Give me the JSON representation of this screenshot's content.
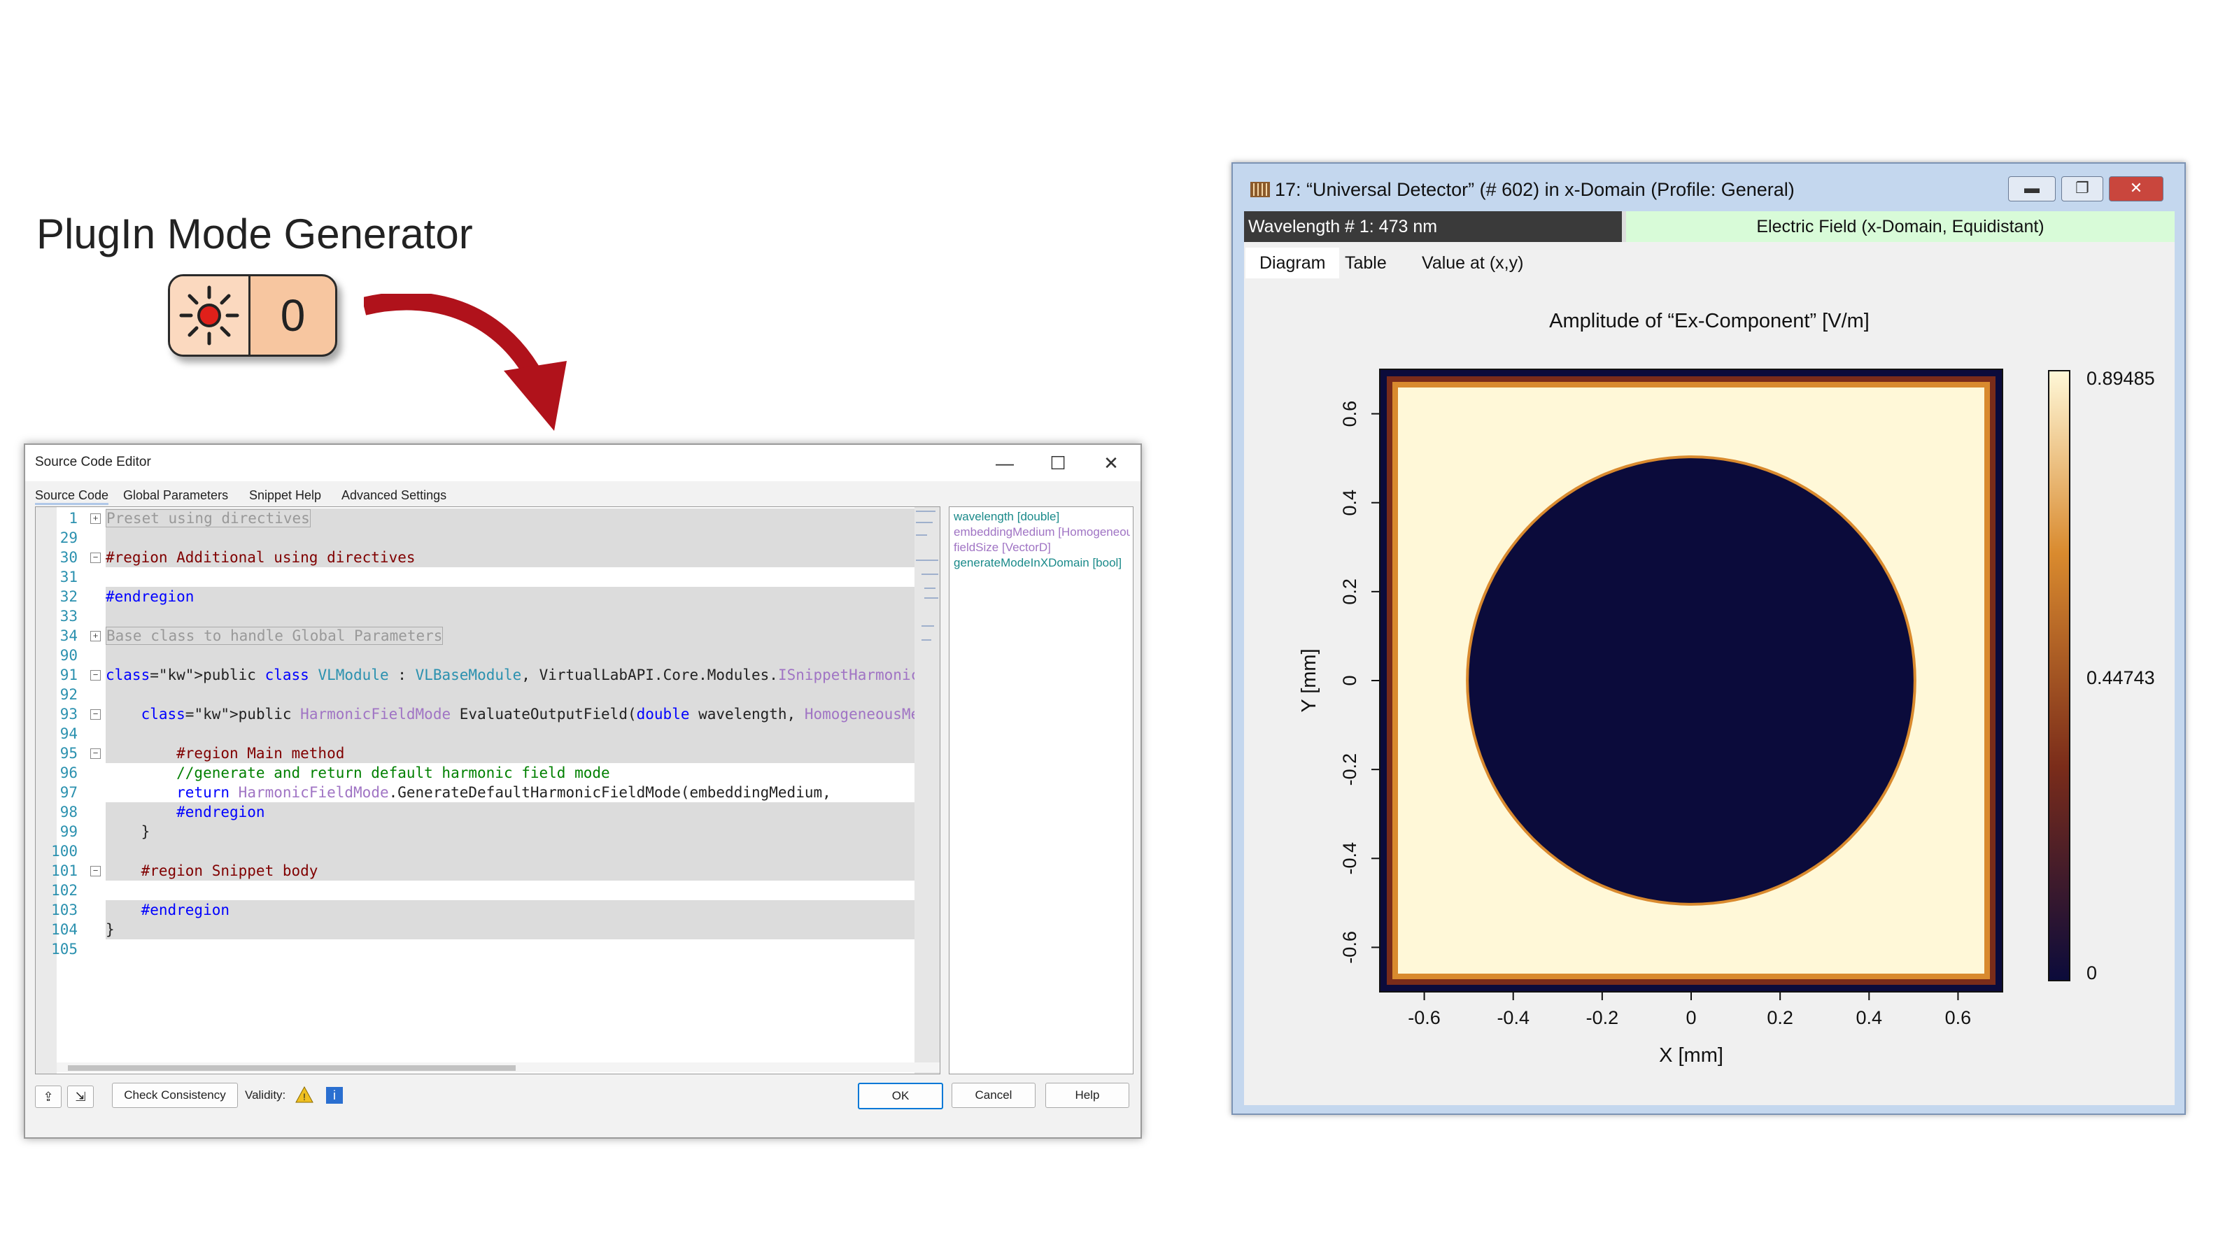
{
  "plugin": {
    "title": "PlugIn Mode Generator",
    "count": "0",
    "icon": "sun-light-source-icon"
  },
  "editor": {
    "title": "Source Code Editor",
    "tabs": [
      "Source Code",
      "Global Parameters",
      "Snippet Help",
      "Advanced Settings"
    ],
    "window_buttons": {
      "minimize": "—",
      "maximize": "☐",
      "close": "✕"
    },
    "lines": [
      {
        "num": "1",
        "text": "Preset using directives",
        "style": "collapsed",
        "fold": "+"
      },
      {
        "num": "29",
        "text": ""
      },
      {
        "num": "30",
        "text": "#region Additional using directives",
        "style": "region",
        "fold": "−"
      },
      {
        "num": "31",
        "text": ""
      },
      {
        "num": "32",
        "text": "#endregion",
        "style": "kw"
      },
      {
        "num": "33",
        "text": ""
      },
      {
        "num": "34",
        "text": "Base class to handle Global Parameters",
        "style": "collapsed",
        "fold": "+"
      },
      {
        "num": "90",
        "text": ""
      },
      {
        "num": "91",
        "text": "public class VLModule : VLBaseModule, VirtualLabAPI.Core.Modules.ISnippetHarmonicF",
        "style": "class",
        "fold": "−"
      },
      {
        "num": "92",
        "text": ""
      },
      {
        "num": "93",
        "text": "    public HarmonicFieldMode EvaluateOutputField(double wavelength, HomogeneousMed",
        "style": "method",
        "fold": "−"
      },
      {
        "num": "94",
        "text": ""
      },
      {
        "num": "95",
        "text": "        #region Main method",
        "style": "region",
        "fold": "−"
      },
      {
        "num": "96",
        "text": "        //generate and return default harmonic field mode",
        "style": "comment"
      },
      {
        "num": "97",
        "text": "        return HarmonicFieldMode.GenerateDefaultHarmonicFieldMode(embeddingMedium,",
        "style": "return"
      },
      {
        "num": "98",
        "text": "        #endregion",
        "style": "kw"
      },
      {
        "num": "99",
        "text": "    }"
      },
      {
        "num": "100",
        "text": ""
      },
      {
        "num": "101",
        "text": "    #region Snippet body",
        "style": "region",
        "fold": "−"
      },
      {
        "num": "102",
        "text": ""
      },
      {
        "num": "103",
        "text": "    #endregion",
        "style": "kw"
      },
      {
        "num": "104",
        "text": "}"
      },
      {
        "num": "105",
        "text": ""
      }
    ],
    "members": [
      {
        "text": "wavelength [double]",
        "color": "#1a8a8a"
      },
      {
        "text": "embeddingMedium [HomogeneousMedium]",
        "color": "#a074c4"
      },
      {
        "text": "fieldSize [VectorD]",
        "color": "#a074c4"
      },
      {
        "text": "generateModeInXDomain [bool]",
        "color": "#1a8a8a"
      }
    ],
    "footer": {
      "check_consistency": "Check Consistency",
      "validity_label": "Validity:",
      "ok": "OK",
      "cancel": "Cancel",
      "help": "Help"
    }
  },
  "detector": {
    "title": "17: “Universal Detector” (# 602) in x-Domain (Profile: General)",
    "window_buttons": {
      "minimize": "▬",
      "restore": "❐",
      "close": "✕"
    },
    "wavelength_label": "Wavelength # 1: 473 nm",
    "field_label": "Electric Field (x-Domain, Equidistant)",
    "tabs": [
      "Diagram",
      "Table",
      "Value at (x,y)"
    ]
  },
  "chart_data": {
    "type": "heatmap",
    "title": "Amplitude of “Ex-Component”  [V/m]",
    "xlabel": "X [mm]",
    "ylabel": "Y [mm]",
    "xlim": [
      -0.7,
      0.7
    ],
    "ylim": [
      -0.7,
      0.7
    ],
    "x_ticks": [
      "-0.6",
      "-0.4",
      "-0.2",
      "0",
      "0.2",
      "0.4",
      "0.6"
    ],
    "y_ticks": [
      "0.6",
      "0.4",
      "0.2",
      "0",
      "-0.2",
      "-0.4",
      "-0.6"
    ],
    "colorbar": {
      "max": "0.89485",
      "mid": "0.44743",
      "min": "0"
    },
    "colormap": [
      "#0b0b3b",
      "#7a2c1a",
      "#d98a2e",
      "#fff8d8"
    ],
    "field": {
      "background_value": 0.89485,
      "aperture_radius_mm": 0.5,
      "aperture_value": 0,
      "aperture_center": [
        0,
        0
      ]
    }
  }
}
